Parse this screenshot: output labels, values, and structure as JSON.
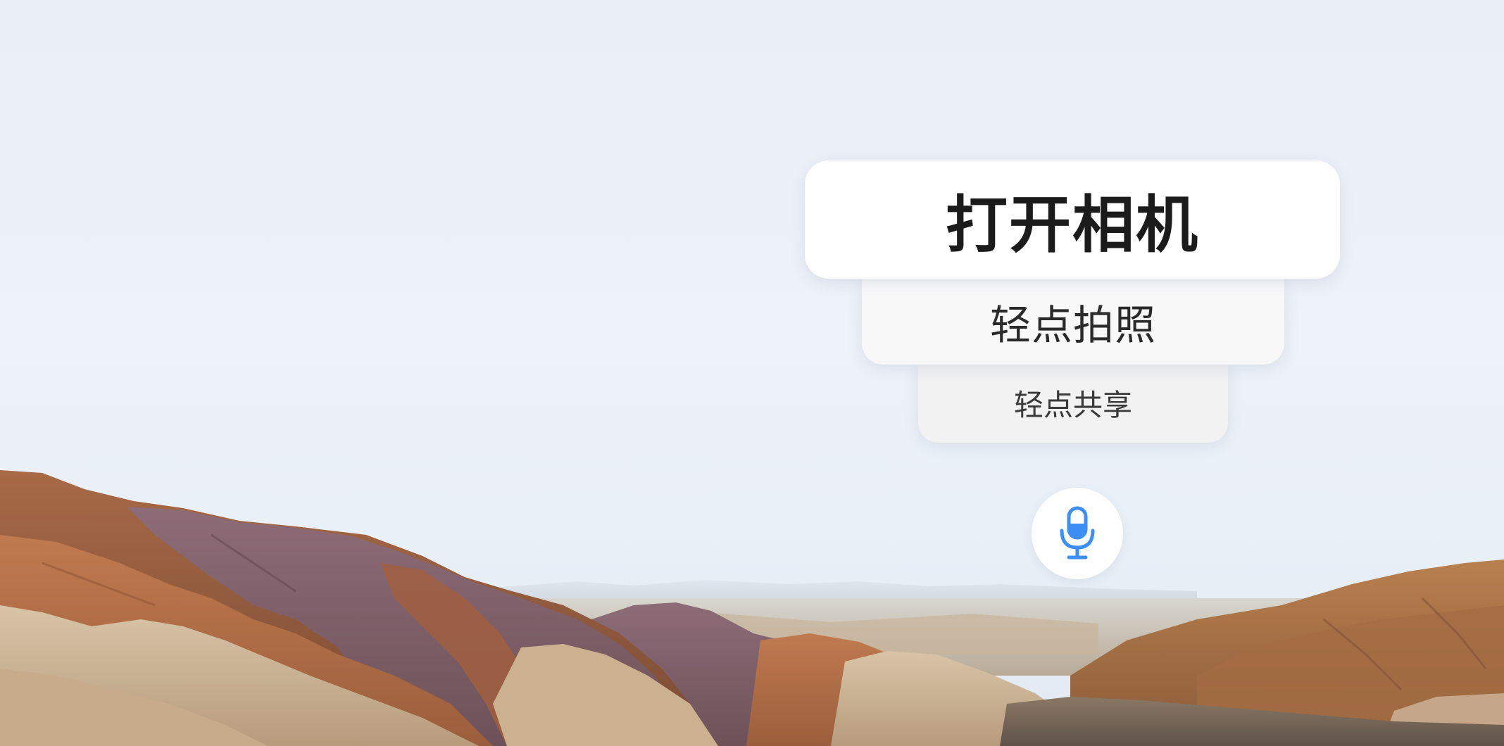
{
  "voice_suggestions": {
    "primary": "打开相机",
    "secondary": "轻点拍照",
    "tertiary": "轻点共享"
  },
  "microphone": {
    "icon": "microphone-icon",
    "color": "#3d8ef5"
  },
  "wallpaper": {
    "subject": "desert-mountain-landscape"
  }
}
